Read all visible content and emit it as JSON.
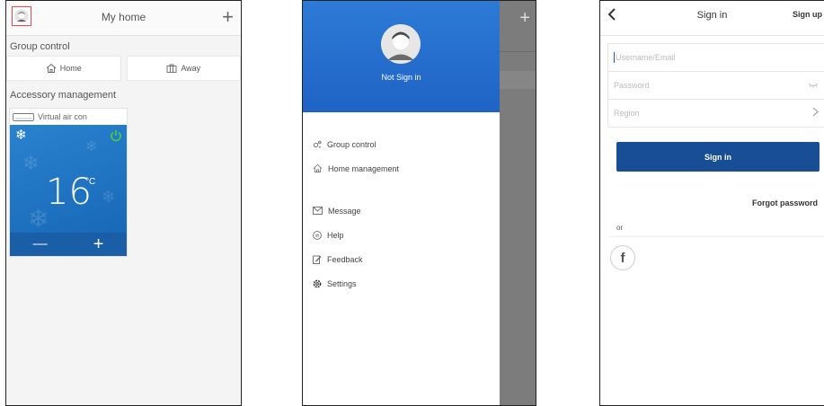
{
  "home": {
    "title": "My home",
    "group_section": "Group control",
    "home_btn": "Home",
    "away_btn": "Away",
    "accessory_section": "Accessory management",
    "device_name": "Virtual air con",
    "temperature": "16",
    "unit": "°C",
    "minus": "—",
    "plus": "+"
  },
  "drawer": {
    "status": "Not Sign in",
    "menu_top": [
      {
        "label": "Group control",
        "icon": "group-control-icon"
      },
      {
        "label": "Home management",
        "icon": "home-icon"
      }
    ],
    "menu_bottom": [
      {
        "label": "Message",
        "icon": "message-icon"
      },
      {
        "label": "Help",
        "icon": "help-icon"
      },
      {
        "label": "Feedback",
        "icon": "feedback-icon"
      },
      {
        "label": "Settings",
        "icon": "settings-icon"
      }
    ]
  },
  "signin": {
    "title": "Sign in",
    "signup": "Sign up",
    "username_placeholder": "Username/Email",
    "password_placeholder": "Password",
    "region_placeholder": "Region",
    "button": "Sign in",
    "forgot": "Forgot password",
    "or": "or",
    "facebook": "f"
  },
  "colors": {
    "ac_blue": "#1f75c8",
    "power_green": "#4cd137",
    "drawer_blue": "#2a70d2",
    "signin_blue": "#174e95",
    "highlight_red": "#e84b4b"
  }
}
